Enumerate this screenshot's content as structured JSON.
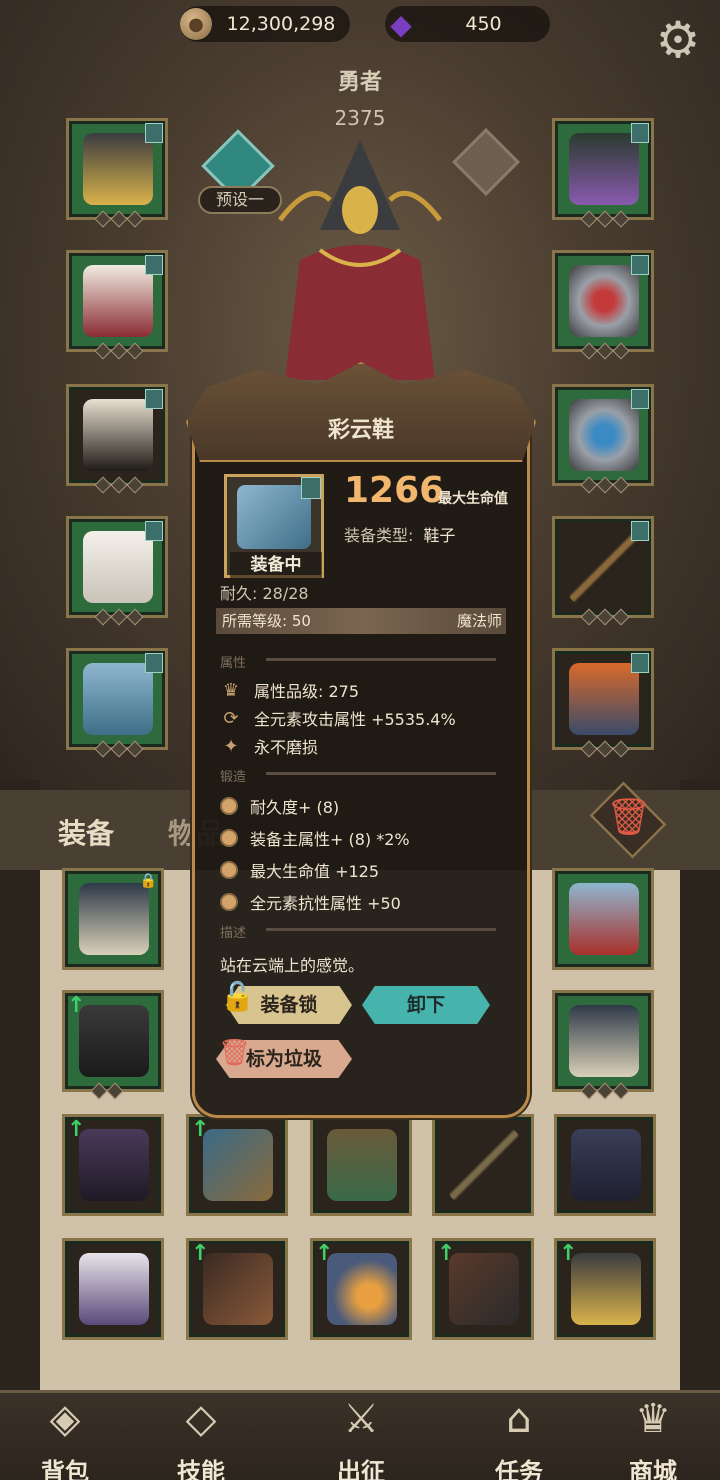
{
  "currency": {
    "coins": "12,300,298",
    "gems": "450"
  },
  "hero": {
    "name": "勇者",
    "power": "2375",
    "preset_label": "预设一"
  },
  "tabs": {
    "equip": "装备",
    "items": "物品"
  },
  "tooltip": {
    "title": "彩云鞋",
    "value": "1266",
    "value_label": "最大生命值",
    "type_label": "装备类型:",
    "type_value": "鞋子",
    "equipped_label": "装备中",
    "durability": "耐久: 28/28",
    "required_level": "所需等级: 50",
    "required_class": "魔法师",
    "sections": {
      "attributes": "属性",
      "forging": "锻造",
      "description": "描述"
    },
    "attributes": [
      {
        "icon": "crown-icon",
        "text": "属性品级: 275"
      },
      {
        "icon": "cycle-icon",
        "text": "全元素攻击属性 +5535.4%"
      },
      {
        "icon": "sparkle-icon",
        "text": "永不磨损"
      }
    ],
    "forging": [
      "耐久度+ (8)",
      "装备主属性+ (8) *2%",
      "最大生命值 +125",
      "全元素抗性属性 +50"
    ],
    "description": "站在云端上的感觉。",
    "buttons": {
      "lock": "装备锁",
      "unequip": "卸下",
      "junk": "标为垃圾"
    }
  },
  "bottom_nav": [
    {
      "label": "背包",
      "icon": "bag-icon"
    },
    {
      "label": "技能",
      "icon": "skill-book-icon"
    },
    {
      "label": "出征",
      "icon": "battle-map-icon"
    },
    {
      "label": "任务",
      "icon": "quest-scroll-icon"
    },
    {
      "label": "商城",
      "icon": "shop-crown-icon"
    }
  ],
  "colors": {
    "accent_gold": "#b98a4a",
    "value_orange": "#f2b66e",
    "unequip_teal": "#47b3ad",
    "junk_red": "#e06a5a"
  }
}
